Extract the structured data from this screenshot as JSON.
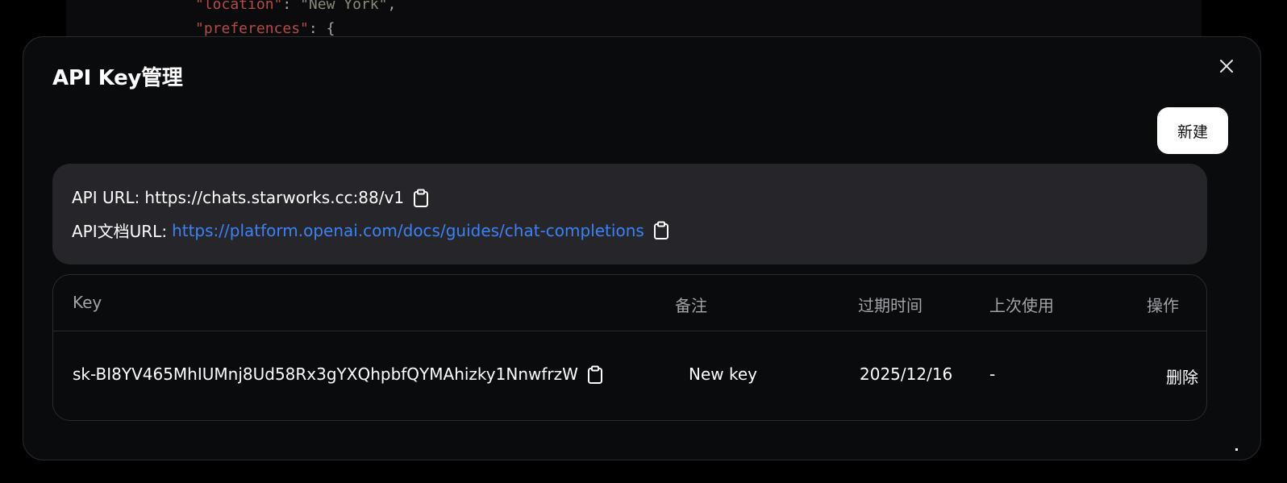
{
  "background_code": {
    "line1": {
      "key": "\"location\"",
      "sep": ": ",
      "value": "\"New York\"",
      "tail": ","
    },
    "line2": {
      "key": "\"preferences\"",
      "sep": ": ",
      "value": "{"
    }
  },
  "modal": {
    "title": "API Key管理",
    "close_icon": "close-icon",
    "new_button_label": "新建"
  },
  "info": {
    "api_url_label": "API URL:",
    "api_url_value": "https://chats.starworks.cc:88/v1",
    "doc_url_label": "API文档URL:",
    "doc_url_value": "https://platform.openai.com/docs/guides/chat-completions",
    "copy_icon": "clipboard-icon"
  },
  "table": {
    "columns": [
      "Key",
      "备注",
      "过期时间",
      "上次使用",
      "操作"
    ],
    "rows": [
      {
        "key": "sk-BI8YV465MhIUMnj8Ud58Rx3gYXQhpbfQYMAhizky1NnwfrzW",
        "note": "New key",
        "expires": "2025/12/16",
        "last_used": "-",
        "action": "删除"
      }
    ]
  },
  "colors": {
    "page_bg": "#000000",
    "modal_bg": "#0a0b0d",
    "panel_bg": "#26262a",
    "border": "#2a2b30",
    "link": "#3b82f6",
    "header_text": "#a3a3a8"
  }
}
